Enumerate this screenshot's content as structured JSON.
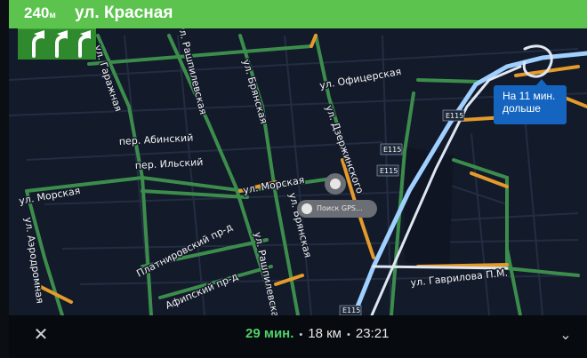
{
  "banner": {
    "distance_value": "240",
    "distance_unit": "м",
    "street": "ул. Красная"
  },
  "map": {
    "labels": {
      "garazhnaya": "ул. Гаражная",
      "rashpilevskaya_top": "ул. Рашпилевская",
      "bryanskaya_top": "ул. Брянская",
      "ofitserskaya": "ул. Офицерская",
      "dzerzhinskogo": "ул. Дзержинского",
      "abinsky": "пер. Абинский",
      "ilsky": "пер. Ильский",
      "morskaya_left": "ул. Морская",
      "morskaya_center": "ул. Морская",
      "aerodromnaya": "ул. Аэродромная",
      "bryanskaya_mid": "ул. Брянская",
      "platnirovsky": "Платнировский пр-д",
      "afipsky": "Афипский пр-д",
      "rashpilevskaya_bottom": "ул. Рашпилевская",
      "gavrilova": "ул. Гаврилова П.М.",
      "e115_1": "E115",
      "e115_2": "E115",
      "e115_3": "E115",
      "e115_4": "E115"
    },
    "gps_chip": "Поиск GPS...",
    "eta_alt": {
      "line1": "На 11 мин.",
      "line2": "дольше"
    }
  },
  "bottom": {
    "close_icon": "✕",
    "eta_minutes": "29 мин.",
    "distance": "18 км",
    "arrival_time": "23:21",
    "separator": "•",
    "expand_icon": "⌄"
  },
  "colors": {
    "banner": "#5cc34f",
    "lane_panel": "#2f8a2d",
    "map_bg": "#131a2a",
    "road_green": "#3c8d4c",
    "road_orange": "#e59a2c",
    "route_blue": "#9fd0ff",
    "eta_green": "#4fd16b"
  }
}
